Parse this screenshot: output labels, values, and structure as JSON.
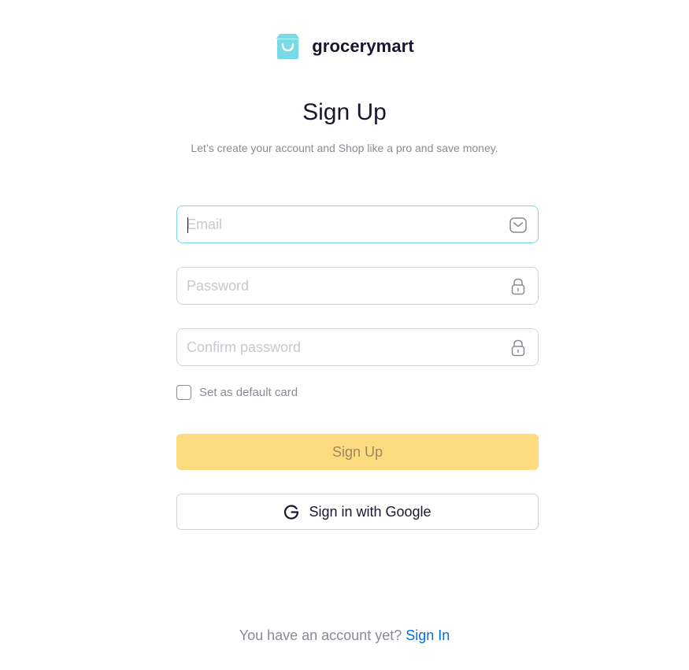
{
  "brand": {
    "name": "grocerymart",
    "logo_icon": "shopping-bag-icon",
    "logo_color": "#77dae6"
  },
  "header": {
    "title": "Sign Up",
    "subtitle": "Let’s create your account and Shop like a pro and save money."
  },
  "form": {
    "email": {
      "placeholder": "Email",
      "value": "",
      "icon": "mail-icon"
    },
    "password": {
      "placeholder": "Password",
      "value": "",
      "icon": "lock-icon"
    },
    "confirm_password": {
      "placeholder": "Confirm password",
      "value": "",
      "icon": "lock-icon"
    },
    "default_card": {
      "label": "Set as default card",
      "checked": false
    },
    "submit_label": "Sign Up",
    "google_label": "Sign in with Google"
  },
  "footer": {
    "prompt": "You have an account yet?",
    "link_label": "Sign In"
  },
  "colors": {
    "accent": "#ffdb80",
    "focus_border": "#77dae6",
    "link": "#0071dc",
    "muted_text": "#8a8a94"
  }
}
